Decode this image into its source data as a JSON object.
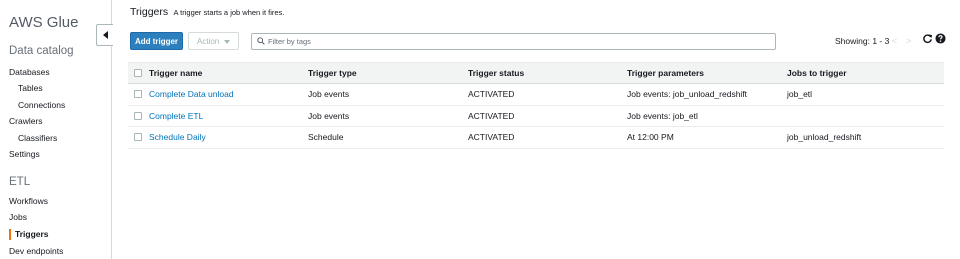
{
  "sidebar": {
    "brand": "AWS Glue",
    "data_catalog": {
      "title": "Data catalog",
      "items": [
        {
          "label": "Databases"
        },
        {
          "label": "Tables"
        },
        {
          "label": "Connections"
        },
        {
          "label": "Crawlers"
        },
        {
          "label": "Classifiers"
        },
        {
          "label": "Settings"
        }
      ]
    },
    "etl": {
      "title": "ETL",
      "items": [
        {
          "label": "Workflows"
        },
        {
          "label": "Jobs"
        },
        {
          "label": "Triggers",
          "active": true
        },
        {
          "label": "Dev endpoints"
        }
      ]
    },
    "accent_color": "#ec7211"
  },
  "header": {
    "title": "Triggers",
    "description": "A trigger starts a job when it fires."
  },
  "toolbar": {
    "add_label": "Add trigger",
    "action_label": "Action",
    "filter_placeholder": "Filter by tags",
    "showing": "Showing: 1 - 3",
    "prev": "<",
    "next": ">"
  },
  "table": {
    "columns": [
      "Trigger name",
      "Trigger type",
      "Trigger status",
      "Trigger parameters",
      "Jobs to trigger"
    ],
    "rows": [
      {
        "name": "Complete Data unload",
        "type": "Job events",
        "status": "ACTIVATED",
        "params": "Job events: job_unload_redshift",
        "jobs": "job_etl"
      },
      {
        "name": "Complete ETL",
        "type": "Job events",
        "status": "ACTIVATED",
        "params": "Job events: job_etl",
        "jobs": ""
      },
      {
        "name": "Schedule Daily",
        "type": "Schedule",
        "status": "ACTIVATED",
        "params": "At 12:00 PM",
        "jobs": "job_unload_redshift"
      }
    ]
  },
  "colors": {
    "primary": "#2e7fbd",
    "link": "#0073bb",
    "header_bg": "#f2f3f3"
  },
  "icons": [
    "collapse-icon",
    "search-icon",
    "refresh-icon",
    "help-icon",
    "caret-down-icon"
  ]
}
